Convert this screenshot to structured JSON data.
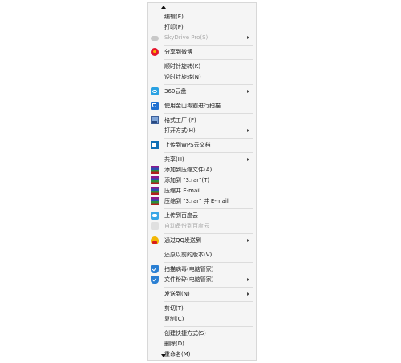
{
  "menu": {
    "items": [
      {
        "label": "编辑(E)"
      },
      {
        "label": "打印(P)"
      },
      {
        "label": "SkyDrive Pro(S)"
      },
      {
        "label": "分享到微博"
      },
      {
        "label": "顺时针旋转(K)"
      },
      {
        "label": "逆时针旋转(N)"
      },
      {
        "label": "360云盘"
      },
      {
        "label": "使用金山毒霸进行扫描"
      },
      {
        "label": "格式工厂 (F)"
      },
      {
        "label": "打开方式(H)"
      },
      {
        "label": "上传到WPS云文档"
      },
      {
        "label": "共享(H)"
      },
      {
        "label": "添加到压缩文件(A)..."
      },
      {
        "label": "添加到 \"3.rar\"(T)"
      },
      {
        "label": "压缩并 E-mail..."
      },
      {
        "label": "压缩到 \"3.rar\" 并 E-mail"
      },
      {
        "label": "上传到百度云"
      },
      {
        "label": "自动备份到百度云"
      },
      {
        "label": "通过QQ发送到"
      },
      {
        "label": "还原以前的版本(V)"
      },
      {
        "label": "扫描病毒(电脑管家)"
      },
      {
        "label": "文件粉碎(电脑管家)"
      },
      {
        "label": "发送到(N)"
      },
      {
        "label": "剪切(T)"
      },
      {
        "label": "复制(C)"
      },
      {
        "label": "创建快捷方式(S)"
      },
      {
        "label": "删除(D)"
      },
      {
        "label": "重命名(M)"
      }
    ]
  }
}
